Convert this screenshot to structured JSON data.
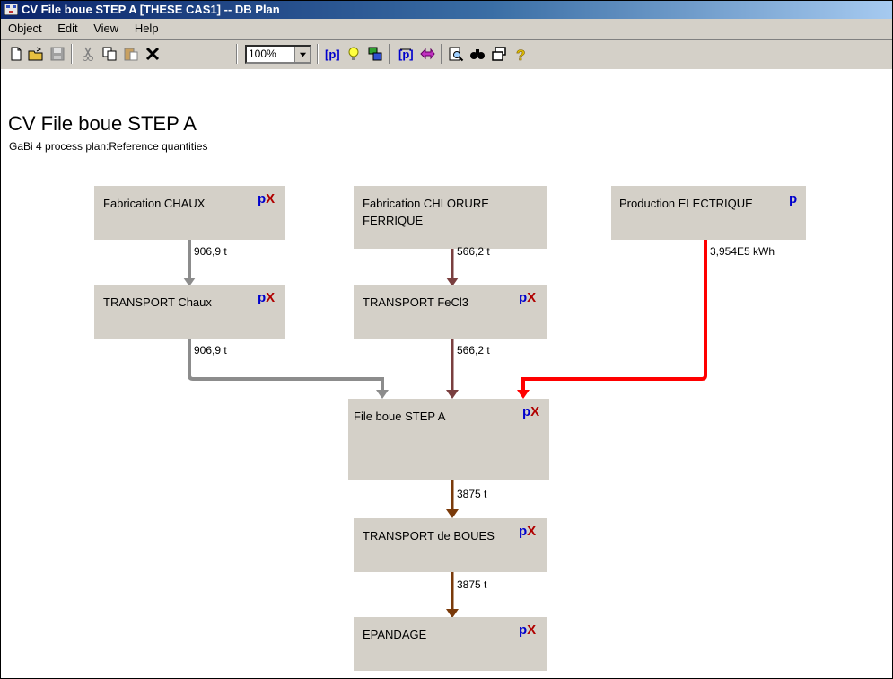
{
  "window": {
    "title": "CV File boue STEP A [THESE CAS1] -- DB Plan"
  },
  "menu": [
    "Object",
    "Edit",
    "View",
    "Help"
  ],
  "toolbar": {
    "zoom_value": "100%"
  },
  "plan": {
    "title": "CV File boue STEP A",
    "subtitle": "GaBi 4 process plan:Reference quantities"
  },
  "processes": [
    {
      "name": "Fabrication CHAUX",
      "badge_p": "p",
      "badge_x": "X"
    },
    {
      "name": "Fabrication CHLORURE\nFERRIQUE",
      "badge_p": "",
      "badge_x": ""
    },
    {
      "name": "Production ELECTRIQUE",
      "badge_p": "p",
      "badge_x": ""
    },
    {
      "name": "TRANSPORT Chaux",
      "badge_p": "p",
      "badge_x": "X"
    },
    {
      "name": "TRANSPORT FeCl3",
      "badge_p": "p",
      "badge_x": "X"
    },
    {
      "name": "File boue STEP A",
      "badge_p": "p",
      "badge_x": "X"
    },
    {
      "name": "TRANSPORT de BOUES",
      "badge_p": "p",
      "badge_x": "X"
    },
    {
      "name": "EPANDAGE",
      "badge_p": "p",
      "badge_x": "X"
    }
  ],
  "flows": [
    {
      "amount": "906,9 t",
      "color": "#8c8c8c"
    },
    {
      "amount": "566,2 t",
      "color": "#7a3f3f"
    },
    {
      "amount": "3,954E5 kWh",
      "color": "#ff0000"
    },
    {
      "amount": "906,9 t",
      "color": "#8c8c8c"
    },
    {
      "amount": "566,2 t",
      "color": "#7a3f3f"
    },
    {
      "amount": "3875 t",
      "color": "#7a3a0a"
    },
    {
      "amount": "3875 t",
      "color": "#7a3a0a"
    }
  ],
  "colors": {
    "titlebar": "#0a246a",
    "process_box": "#d4d0c8",
    "badge_p": "#0000cc",
    "badge_x": "#b00000"
  }
}
